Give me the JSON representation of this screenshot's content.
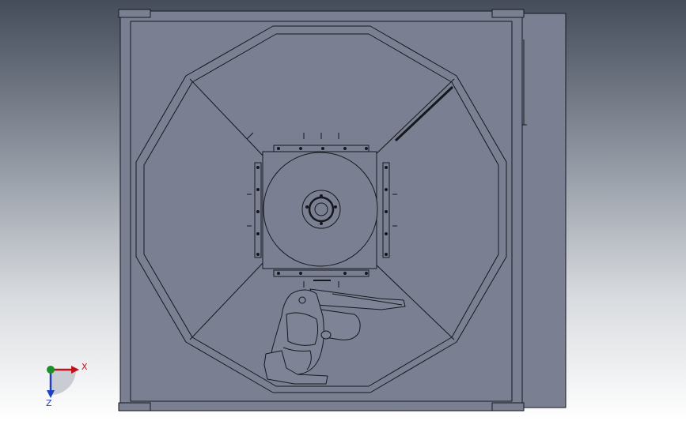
{
  "triad": {
    "x_label": "X",
    "z_label": "Z",
    "x_color": "#c0121b",
    "y_color": "#1a8f2a",
    "z_color": "#1f3fbf"
  },
  "model": {
    "body_fill": "#7a7f91",
    "edge_color": "#16181f"
  }
}
